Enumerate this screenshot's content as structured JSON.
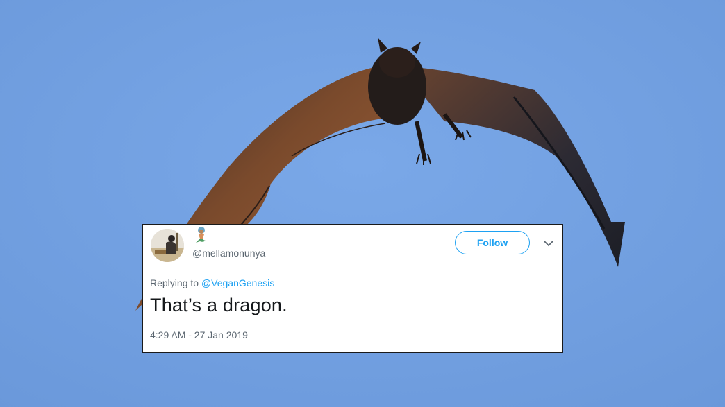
{
  "background": {
    "sky_color": "#6f9ee0",
    "subject_icon": "flying-bat"
  },
  "tweet": {
    "handle": "@mellamonunya",
    "follow_label": "Follow",
    "menu_icon": "chevron-down-icon",
    "reply_prefix": "Replying to",
    "reply_mention": "@VeganGenesis",
    "text": "That’s a dragon.",
    "timestamp": "4:29 AM - 27 Jan 2019",
    "accent_color": "#1da1f2"
  }
}
